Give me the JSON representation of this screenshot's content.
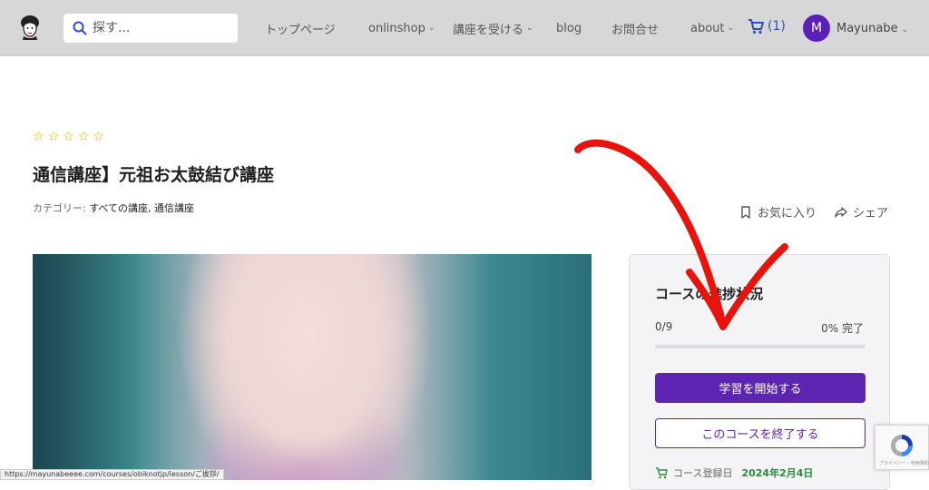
{
  "header": {
    "search_placeholder": "探す...",
    "nav": [
      {
        "label": "トップページ",
        "dropdown": false
      },
      {
        "label": "onlinshop",
        "dropdown": true
      },
      {
        "label": "講座を受ける",
        "dropdown": true
      },
      {
        "label": "blog",
        "dropdown": false
      },
      {
        "label": "お問合せ",
        "dropdown": false
      },
      {
        "label": "about",
        "dropdown": true
      }
    ],
    "cart_count": "(1)",
    "avatar_initial": "M",
    "username": "Mayunabe"
  },
  "course": {
    "rating_stars": 0,
    "rating_max": 5,
    "title": "通信講座】元祖お太鼓結び講座",
    "category_label": "カテゴリー: ",
    "category_value": "すべての講座, 通信講座",
    "favorite_label": "お気に入り",
    "share_label": "シェア"
  },
  "progress_card": {
    "title": "コースの進捗状況",
    "completed": "0/9",
    "percent_label": "0% 完了",
    "percent": 0,
    "start_button": "学習を開始する",
    "finish_button": "このコースを終了する",
    "enroll_label": "コース登録日",
    "enroll_date": "2024年2月4日"
  },
  "statusbar": {
    "url": "https://mayunabeeee.com/courses/obiknotjp/lesson/ご挨拶/"
  },
  "recaptcha": {
    "text": "プライバシー・利用規約"
  },
  "colors": {
    "accent": "#5b24b1",
    "header_bg": "#d7d7d7",
    "cart": "#2d4cc8",
    "star": "#d9a400",
    "arrow": "#e8130c",
    "enroll_date": "#2d8a3a"
  }
}
